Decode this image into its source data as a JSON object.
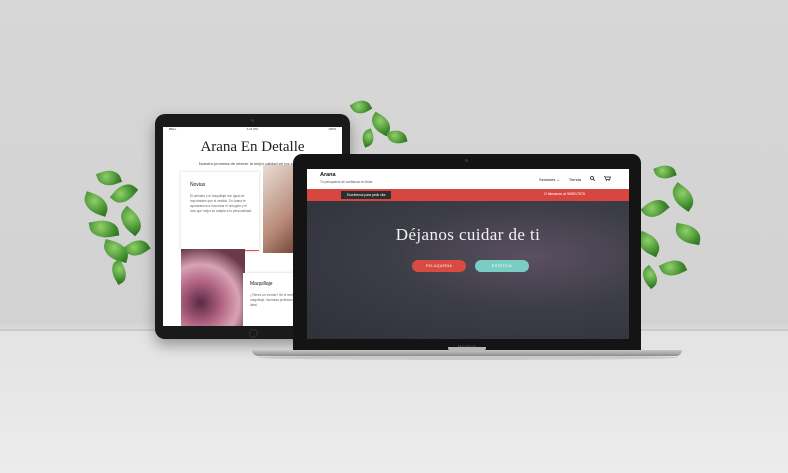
{
  "tablet": {
    "status": {
      "carrier": "BELL",
      "time": "4:21 PM",
      "battery": "100%"
    },
    "title": "Arana En Detalle",
    "subtitle": "Nuestra promesa de ofrecer la mejor calidad en los servicios",
    "card1": {
      "num": "01",
      "title": "Novias",
      "text": "El peinado y el maquillaje son igual de importantes que el vestido. En Arana te ayudaremos a encontrar el recogido y el look que mejor se adapte a tu personalidad."
    },
    "card2": {
      "title": "Maquillaje",
      "text": "¿Tienes un evento? Se el centro de atención con tu maquillaje. Nuestras profesionales te aconsejarán el look ideal."
    }
  },
  "laptop": {
    "header": {
      "brand": "Arana",
      "tagline": "Tu peluquería de confianza en Ibiza"
    },
    "nav": {
      "sessions": "Sesiones",
      "store": "Tienda"
    },
    "cta": "Escríbenos para pedir cita",
    "phone": "O llámanos al 965517576",
    "hero": {
      "title": "Déjanos cuidar de ti",
      "btn1": "PELUQUERÍA",
      "btn2": "ESTÉTICA"
    },
    "model": "MacBook"
  },
  "colors": {
    "accent": "#d8473f",
    "teal": "#79cdc3",
    "dark": "#2e2e2e"
  },
  "icons": [
    "chevron-down-icon",
    "search-icon",
    "cart-icon"
  ]
}
